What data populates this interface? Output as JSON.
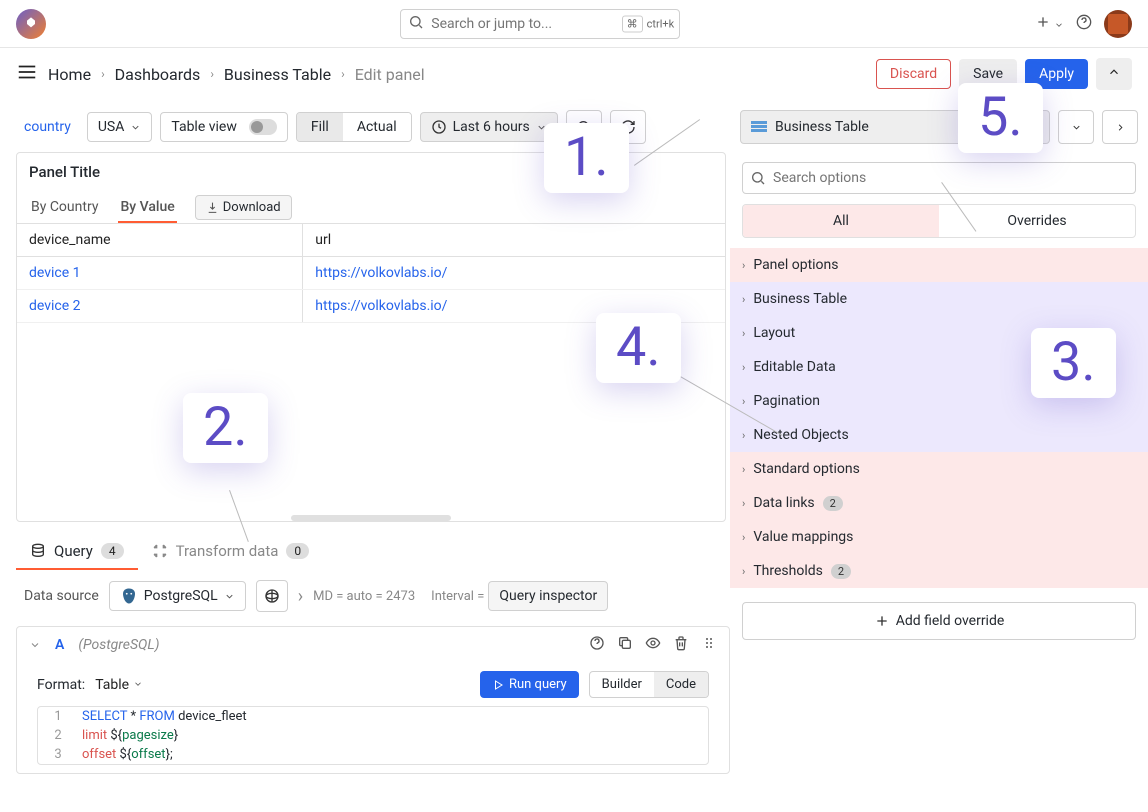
{
  "top": {
    "search_placeholder": "Search or jump to...",
    "shortcut_key": "ctrl+k"
  },
  "breadcrumb": {
    "items": [
      "Home",
      "Dashboards",
      "Business Table",
      "Edit panel"
    ]
  },
  "actions": {
    "discard": "Discard",
    "save": "Save",
    "apply": "Apply"
  },
  "filter_bar": {
    "var_label": "country",
    "var_value": "USA",
    "table_view": "Table view",
    "fill": "Fill",
    "actual": "Actual",
    "time_range": "Last 6 hours"
  },
  "vis_picker": {
    "name": "Business Table"
  },
  "panel": {
    "title": "Panel Title",
    "tabs": [
      "By Country",
      "By Value"
    ],
    "download": "Download",
    "columns": [
      "device_name",
      "url"
    ],
    "rows": [
      {
        "device_name": "device 1",
        "url": "https://volkovlabs.io/"
      },
      {
        "device_name": "device 2",
        "url": "https://volkovlabs.io/"
      }
    ]
  },
  "bottom_tabs": {
    "query": "Query",
    "query_count": "4",
    "transform": "Transform data",
    "transform_count": "0"
  },
  "ds": {
    "label": "Data source",
    "name": "PostgreSQL",
    "meta": "MD = auto = 2473",
    "interval_label": "Interval =",
    "inspector": "Query inspector"
  },
  "query": {
    "letter": "A",
    "source_name": "(PostgreSQL)",
    "format_label": "Format:",
    "format_value": "Table",
    "run": "Run query",
    "builder": "Builder",
    "code": "Code",
    "lines": [
      {
        "n": "1",
        "tokens": [
          [
            "SELECT",
            "kw-blue"
          ],
          [
            " * ",
            ""
          ],
          [
            "FROM",
            "kw-blue"
          ],
          [
            " device_fleet",
            ""
          ]
        ]
      },
      {
        "n": "2",
        "tokens": [
          [
            "limit",
            "kw-red"
          ],
          [
            " ${",
            ""
          ],
          [
            "pagesize",
            "tok-var"
          ],
          [
            "}",
            ""
          ]
        ]
      },
      {
        "n": "3",
        "tokens": [
          [
            "offset",
            "kw-red"
          ],
          [
            " ${",
            ""
          ],
          [
            "offset",
            "tok-var"
          ],
          [
            "};",
            ""
          ]
        ]
      }
    ]
  },
  "options": {
    "search_placeholder": "Search options",
    "tabs": [
      "All",
      "Overrides"
    ],
    "items": [
      {
        "label": "Panel options",
        "hl": "hl-pink"
      },
      {
        "label": "Business Table",
        "hl": "hl-purple"
      },
      {
        "label": "Layout",
        "hl": "hl-purple"
      },
      {
        "label": "Editable Data",
        "hl": "hl-purple"
      },
      {
        "label": "Pagination",
        "hl": "hl-purple"
      },
      {
        "label": "Nested Objects",
        "hl": "hl-purple"
      },
      {
        "label": "Standard options",
        "hl": "hl-pink"
      },
      {
        "label": "Data links",
        "hl": "hl-pink",
        "badge": "2"
      },
      {
        "label": "Value mappings",
        "hl": "hl-pink"
      },
      {
        "label": "Thresholds",
        "hl": "hl-pink",
        "badge": "2"
      }
    ],
    "add_override": "Add field override"
  },
  "annotations": {
    "a1": "1.",
    "a2": "2.",
    "a3": "3.",
    "a4": "4.",
    "a5": "5."
  }
}
